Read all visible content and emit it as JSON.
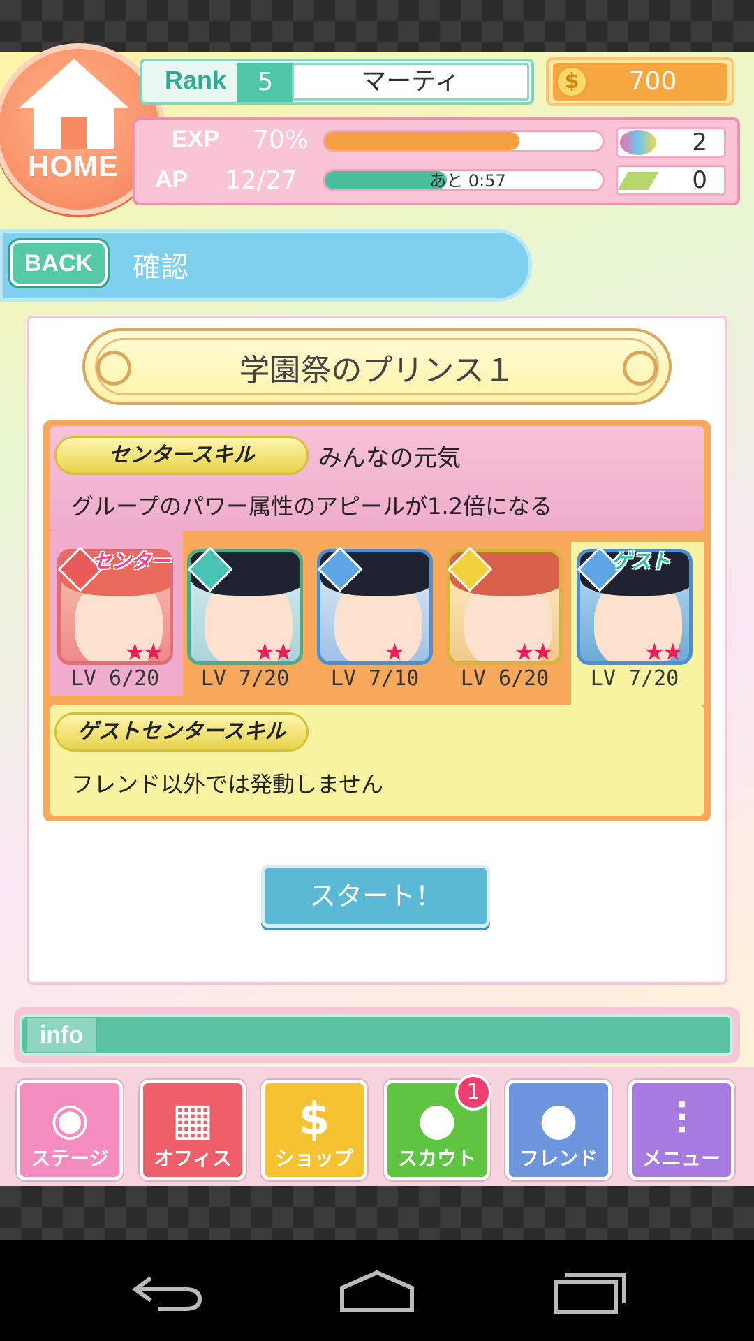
{
  "header": {
    "home_label": "HOME",
    "rank_label": "Rank",
    "rank_value": "5",
    "player_name": "マーティ",
    "coins": "700",
    "coin_icon": "dollar-coin-icon",
    "exp_label": "EXP",
    "exp_value": "70%",
    "exp_progress": 0.7,
    "ap_label": "AP",
    "ap_value": "12/27",
    "ap_progress": 0.44,
    "ap_timer": "あと 0:57",
    "candy_count": "2",
    "ticket_count": "0"
  },
  "subheader": {
    "back_label": "BACK",
    "title": "確認"
  },
  "stage": {
    "title": "学園祭のプリンス１",
    "center_skill_label": "センタースキル",
    "center_skill_name": "みんなの元気",
    "center_skill_desc": "グループのパワー属性のアピールが1.2倍になる",
    "guest_skill_label": "ゲストセンタースキル",
    "guest_skill_desc": "フレンド以外では発動しません",
    "start_label": "スタート！"
  },
  "members": [
    {
      "tag": "センター",
      "level": "LV 6/20",
      "stars": "★★",
      "element": "red"
    },
    {
      "tag": "",
      "level": "LV 7/20",
      "stars": "★★",
      "element": "teal"
    },
    {
      "tag": "",
      "level": "LV 7/10",
      "stars": "★",
      "element": "blue"
    },
    {
      "tag": "",
      "level": "LV 6/20",
      "stars": "★★",
      "element": "yellow"
    },
    {
      "tag": "ゲスト",
      "level": "LV 7/20",
      "stars": "★★",
      "element": "blue"
    }
  ],
  "info": {
    "label": "info"
  },
  "nav": [
    {
      "label": "ステージ",
      "icon": "speaker-icon",
      "color": "#f48cc0"
    },
    {
      "label": "オフィス",
      "icon": "building-icon",
      "color": "#ee5f6a"
    },
    {
      "label": "ショップ",
      "icon": "dollar-icon",
      "color": "#f5c232"
    },
    {
      "label": "スカウト",
      "icon": "scout-person-icon",
      "color": "#5fc441",
      "badge": "1"
    },
    {
      "label": "フレンド",
      "icon": "friend-person-icon",
      "color": "#6c95de"
    },
    {
      "label": "メニュー",
      "icon": "sliders-icon",
      "color": "#a77ae0"
    }
  ]
}
